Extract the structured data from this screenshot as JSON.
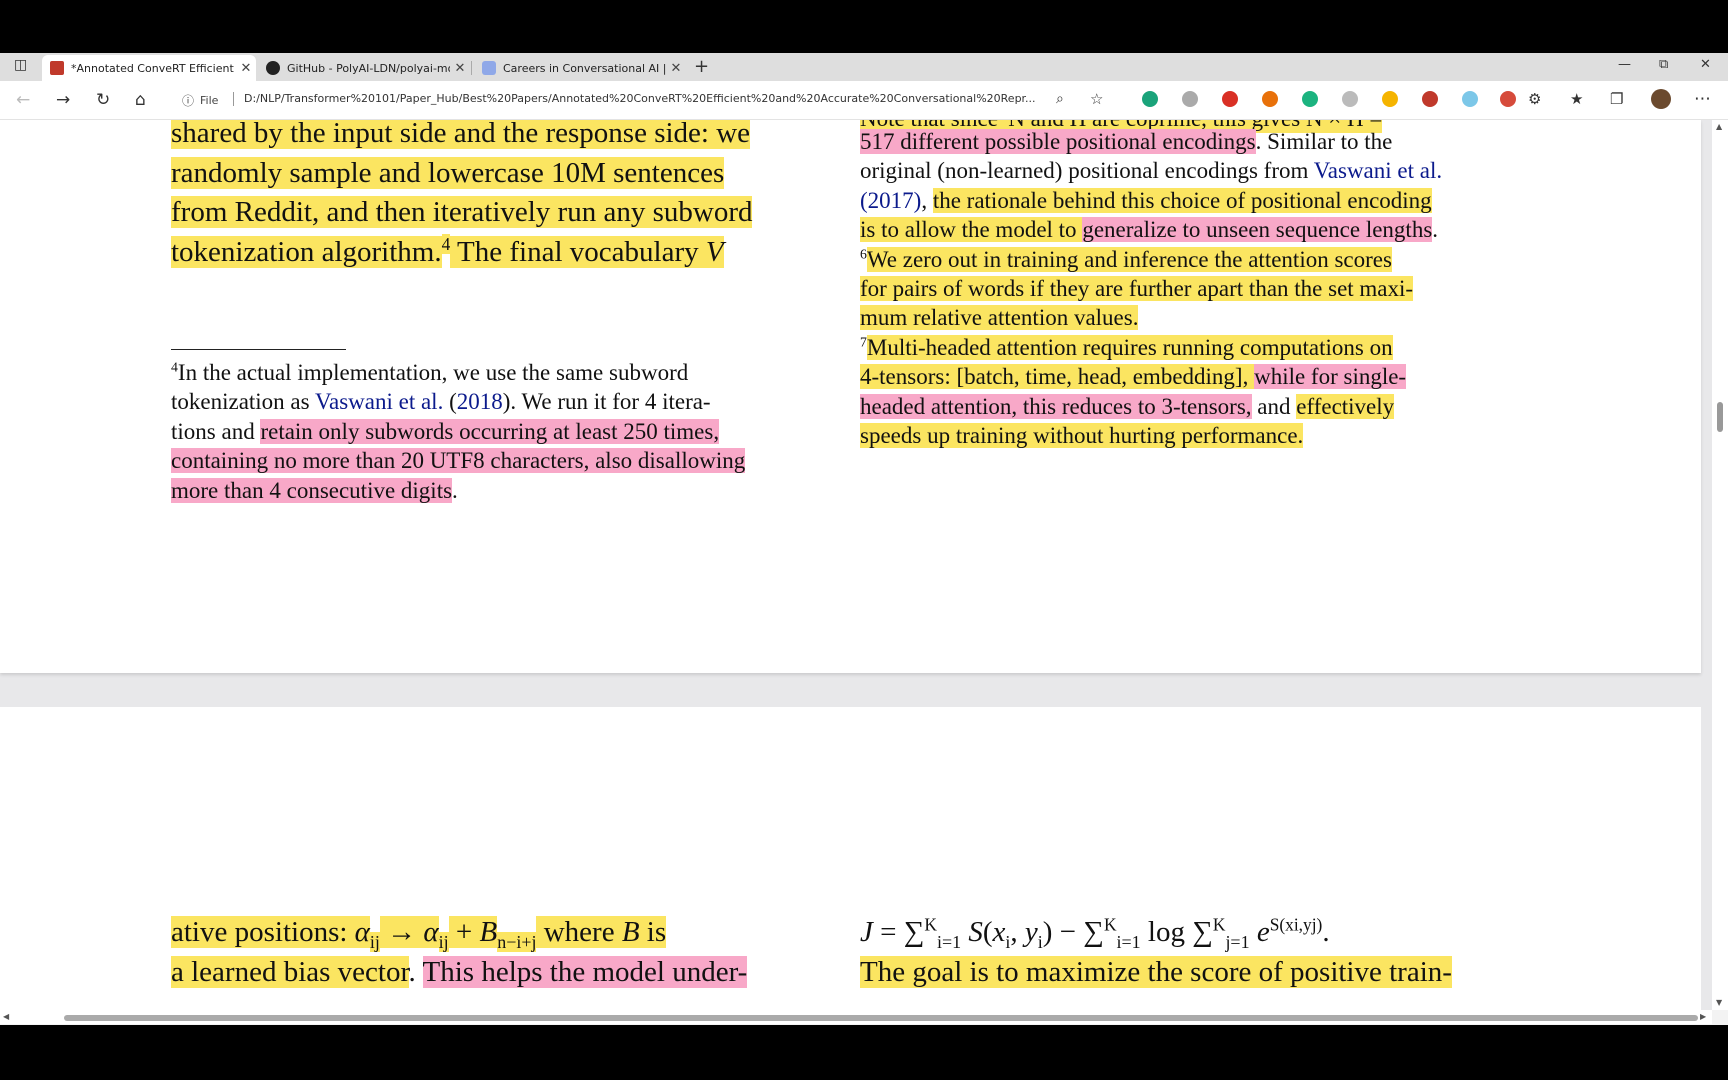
{
  "tabs": [
    {
      "title": "*Annotated ConveRT Efficient ar",
      "icon": "pdf-icon"
    },
    {
      "title": "GitHub - PolyAI-LDN/polyai-mo",
      "icon": "github-icon"
    },
    {
      "title": "Careers in Conversational AI | Pc",
      "icon": "careers-icon"
    }
  ],
  "address": {
    "file_label": "File",
    "url": "D:/NLP/Transformer%20101/Paper_Hub/Best%20Papers/Annotated%20ConveRT%20Efficient%20and%20Accurate%20Conversational%20Repr..."
  },
  "extension_colors": [
    "#1aa37a",
    "#aaaaaa",
    "#d93025",
    "#e8710a",
    "#1bb37f",
    "#bbbbbb",
    "#f5b400",
    "#c0392b",
    "#7cc7e8",
    "#d64b3b"
  ],
  "page1": {
    "left_main": [
      [
        {
          "t": "shared by the input side and the response side: we",
          "h": "y"
        }
      ],
      [
        {
          "t": "randomly sample and lowercase 10M sentences",
          "h": "y"
        }
      ],
      [
        {
          "t": "from Reddit, and then iteratively run any subword",
          "h": "y"
        }
      ],
      [
        {
          "t": "tokenization algorithm.",
          "h": "y"
        },
        {
          "t": "4",
          "h": "y",
          "sup": true
        },
        {
          "t": " The final vocabulary ",
          "h": "y"
        },
        {
          "t": "V",
          "h": "y",
          "i": true
        },
        {
          "t": " ",
          "h": ""
        }
      ]
    ],
    "left_footnote": [
      [
        {
          "t": "    ",
          "h": ""
        },
        {
          "t": "4",
          "h": "",
          "sup": true
        },
        {
          "t": "In the actual implementation, we use the same subword",
          "h": ""
        }
      ],
      [
        {
          "t": "tokenization as ",
          "h": ""
        },
        {
          "t": "Vaswani et al.",
          "h": "",
          "l": true
        },
        {
          "t": " (",
          "h": ""
        },
        {
          "t": "2018",
          "h": "",
          "l": true
        },
        {
          "t": ").  We run it for 4 itera-",
          "h": ""
        }
      ],
      [
        {
          "t": "tions and ",
          "h": ""
        },
        {
          "t": "retain only subwords occurring at least 250 times,",
          "h": "p"
        }
      ],
      [
        {
          "t": "containing no more than 20 UTF8 characters, also disallowing",
          "h": "p"
        }
      ],
      [
        {
          "t": "more than 4 consecutive digits",
          "h": "p"
        },
        {
          "t": ".",
          "h": ""
        }
      ]
    ],
    "right_partial_top": "Note that since  N and H are coprime, this gives  N × H =",
    "right_footnotes": [
      [
        {
          "t": "517 different possible positional encodings",
          "h": "p"
        },
        {
          "t": ".  Similar to the",
          "h": ""
        }
      ],
      [
        {
          "t": "original (non-learned) positional encodings from ",
          "h": ""
        },
        {
          "t": "Vaswani et al.",
          "h": "",
          "l": true
        }
      ],
      [
        {
          "t": "(2017)",
          "h": "",
          "l": true
        },
        {
          "t": ", ",
          "h": ""
        },
        {
          "t": "the rationale behind this choice of positional encoding",
          "h": "y"
        }
      ],
      [
        {
          "t": "is to allow the model to ",
          "h": "y"
        },
        {
          "t": "generalize to unseen sequence lengths",
          "h": "p"
        },
        {
          "t": ".",
          "h": ""
        }
      ],
      [
        {
          "t": "    ",
          "h": ""
        },
        {
          "t": "6",
          "h": "",
          "sup": true
        },
        {
          "t": "We zero out in training and inference the attention scores",
          "h": "y"
        }
      ],
      [
        {
          "t": "for pairs of words if they are further apart than the set maxi-",
          "h": "y"
        }
      ],
      [
        {
          "t": "mum relative attention values.",
          "h": "y"
        }
      ],
      [
        {
          "t": "    ",
          "h": ""
        },
        {
          "t": "7",
          "h": "",
          "sup": true
        },
        {
          "t": "Multi-headed attention requires running computations on",
          "h": "y"
        }
      ],
      [
        {
          "t": "4-tensors: [batch, time, head, embedding], ",
          "h": "y"
        },
        {
          "t": "while for single-",
          "h": "p"
        }
      ],
      [
        {
          "t": "headed attention, this reduces to 3-tensors,",
          "h": "p"
        },
        {
          "t": "  and  ",
          "h": ""
        },
        {
          "t": "effectively",
          "h": "y"
        }
      ],
      [
        {
          "t": "speeds up training without hurting performance.",
          "h": "y"
        }
      ]
    ]
  },
  "page2": {
    "left": [
      [
        {
          "t": "ative positions: ",
          "h": "y"
        },
        {
          "t": "α",
          "h": "y",
          "i": true
        },
        {
          "t": "ij",
          "h": "y",
          "sub": true
        },
        {
          "t": " → ",
          "h": "y"
        },
        {
          "t": "α",
          "h": "y",
          "i": true
        },
        {
          "t": "ij",
          "h": "y",
          "sub": true
        },
        {
          "t": " + ",
          "h": "y"
        },
        {
          "t": "B",
          "h": "y",
          "i": true
        },
        {
          "t": "n−i+j",
          "h": "y",
          "sub": true
        },
        {
          "t": " where ",
          "h": "y"
        },
        {
          "t": "B",
          "h": "y",
          "i": true
        },
        {
          "t": " is",
          "h": "y"
        }
      ],
      [
        {
          "t": "a learned bias vector",
          "h": "y"
        },
        {
          "t": ".  ",
          "h": ""
        },
        {
          "t": "This helps the model under-",
          "h": "p"
        }
      ]
    ],
    "right": [
      [
        {
          "t": "J",
          "h": "",
          "i": true
        },
        {
          "t": "  =  ∑",
          "h": ""
        },
        {
          "t": "K",
          "h": "",
          "sup": true
        },
        {
          "t": "i=1",
          "h": "",
          "sub": true
        },
        {
          "t": " S",
          "h": "",
          "i": true
        },
        {
          "t": "(",
          "h": ""
        },
        {
          "t": "x",
          "h": "",
          "i": true
        },
        {
          "t": "i",
          "h": "",
          "sub": true
        },
        {
          "t": ", ",
          "h": ""
        },
        {
          "t": "y",
          "h": "",
          "i": true
        },
        {
          "t": "i",
          "h": "",
          "sub": true
        },
        {
          "t": ")  −  ∑",
          "h": ""
        },
        {
          "t": "K",
          "h": "",
          "sup": true
        },
        {
          "t": "i=1",
          "h": "",
          "sub": true
        },
        {
          "t": " log ∑",
          "h": ""
        },
        {
          "t": "K",
          "h": "",
          "sup": true
        },
        {
          "t": "j=1",
          "h": "",
          "sub": true
        },
        {
          "t": " e",
          "h": "",
          "i": true
        },
        {
          "t": "S(xi,yj)",
          "h": "",
          "sup": true
        },
        {
          "t": ".",
          "h": ""
        }
      ],
      [
        {
          "t": "The goal is to maximize the score of positive train-",
          "h": "y"
        }
      ]
    ]
  }
}
